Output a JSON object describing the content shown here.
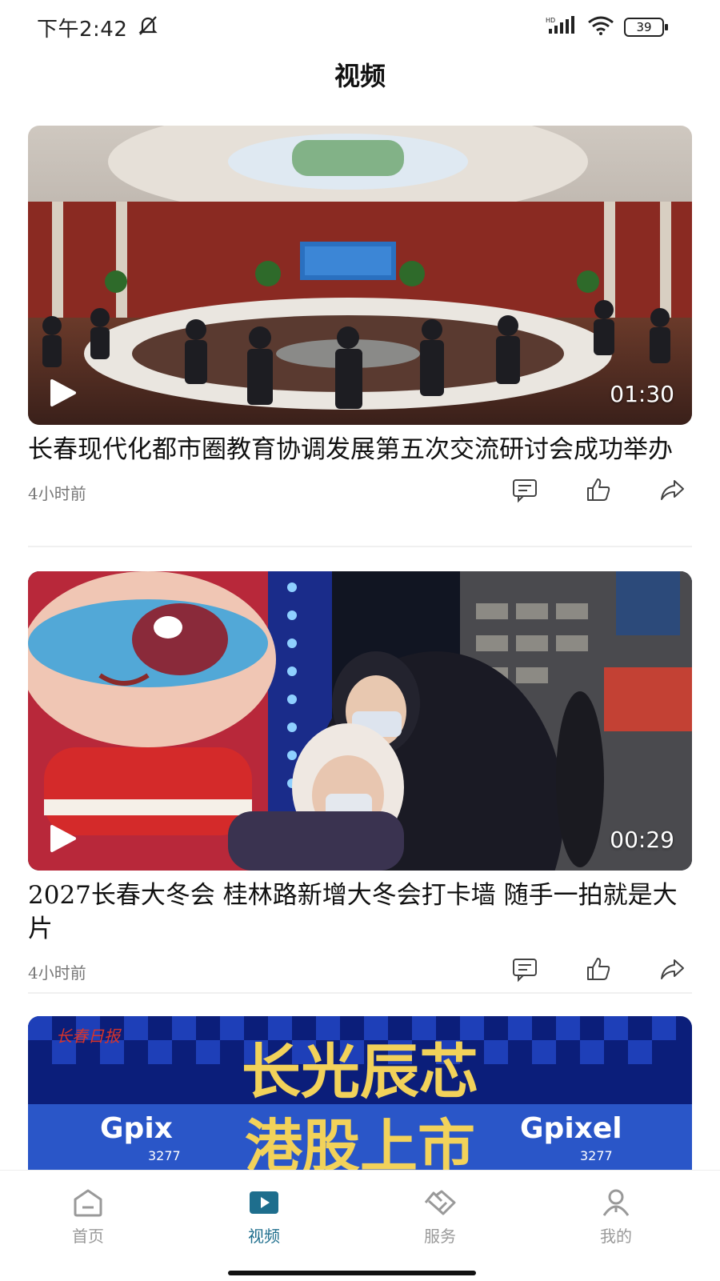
{
  "status": {
    "time": "下午2:42",
    "battery": "39"
  },
  "page": {
    "title": "视频"
  },
  "videos": [
    {
      "title": "长春现代化都市圈教育协调发展第五次交流研讨会成功举办",
      "duration": "01:30",
      "time_ago": "4小时前"
    },
    {
      "title": "2027长春大冬会 桂林路新增大冬会打卡墙  随手一拍就是大片",
      "duration": "00:29",
      "time_ago": "4小时前"
    },
    {
      "title": "",
      "duration": "",
      "time_ago": ""
    }
  ],
  "third_thumb_text": {
    "line1": "长光辰芯",
    "line2": "港股上市",
    "left": "Gpix",
    "right": "Gpixel",
    "code": "3277"
  },
  "tabs": [
    {
      "label": "首页",
      "icon": "home-icon",
      "active": false
    },
    {
      "label": "视频",
      "icon": "video-icon",
      "active": true
    },
    {
      "label": "服务",
      "icon": "service-icon",
      "active": false
    },
    {
      "label": "我的",
      "icon": "profile-icon",
      "active": false
    }
  ],
  "colors": {
    "accent": "#1e6e8d",
    "inactive": "#999999"
  }
}
